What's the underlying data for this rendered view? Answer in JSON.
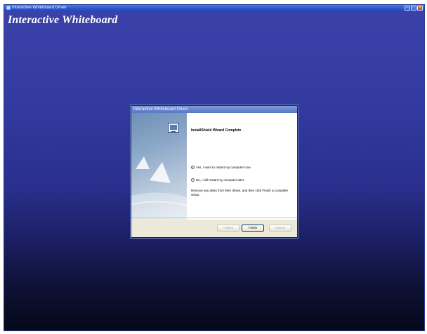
{
  "window": {
    "title": "Interactive Whiteboard Driver",
    "controls": [
      "minimize",
      "maximize",
      "close"
    ]
  },
  "app": {
    "title": "Interactive Whiteboard"
  },
  "dialog": {
    "title": "Interactive Whiteboard Driver",
    "heading": "InstallShield Wizard Complete",
    "options": [
      {
        "label": "Yes, I want to restart my computer now.",
        "selected": true
      },
      {
        "label": "No, I will restart my computer later.",
        "selected": false
      }
    ],
    "instruction": "Remove any disks from their drives, and then click Finish to complete setup.",
    "buttons": {
      "back": "< Back",
      "finish": "Finish",
      "cancel": "Cancel"
    }
  }
}
